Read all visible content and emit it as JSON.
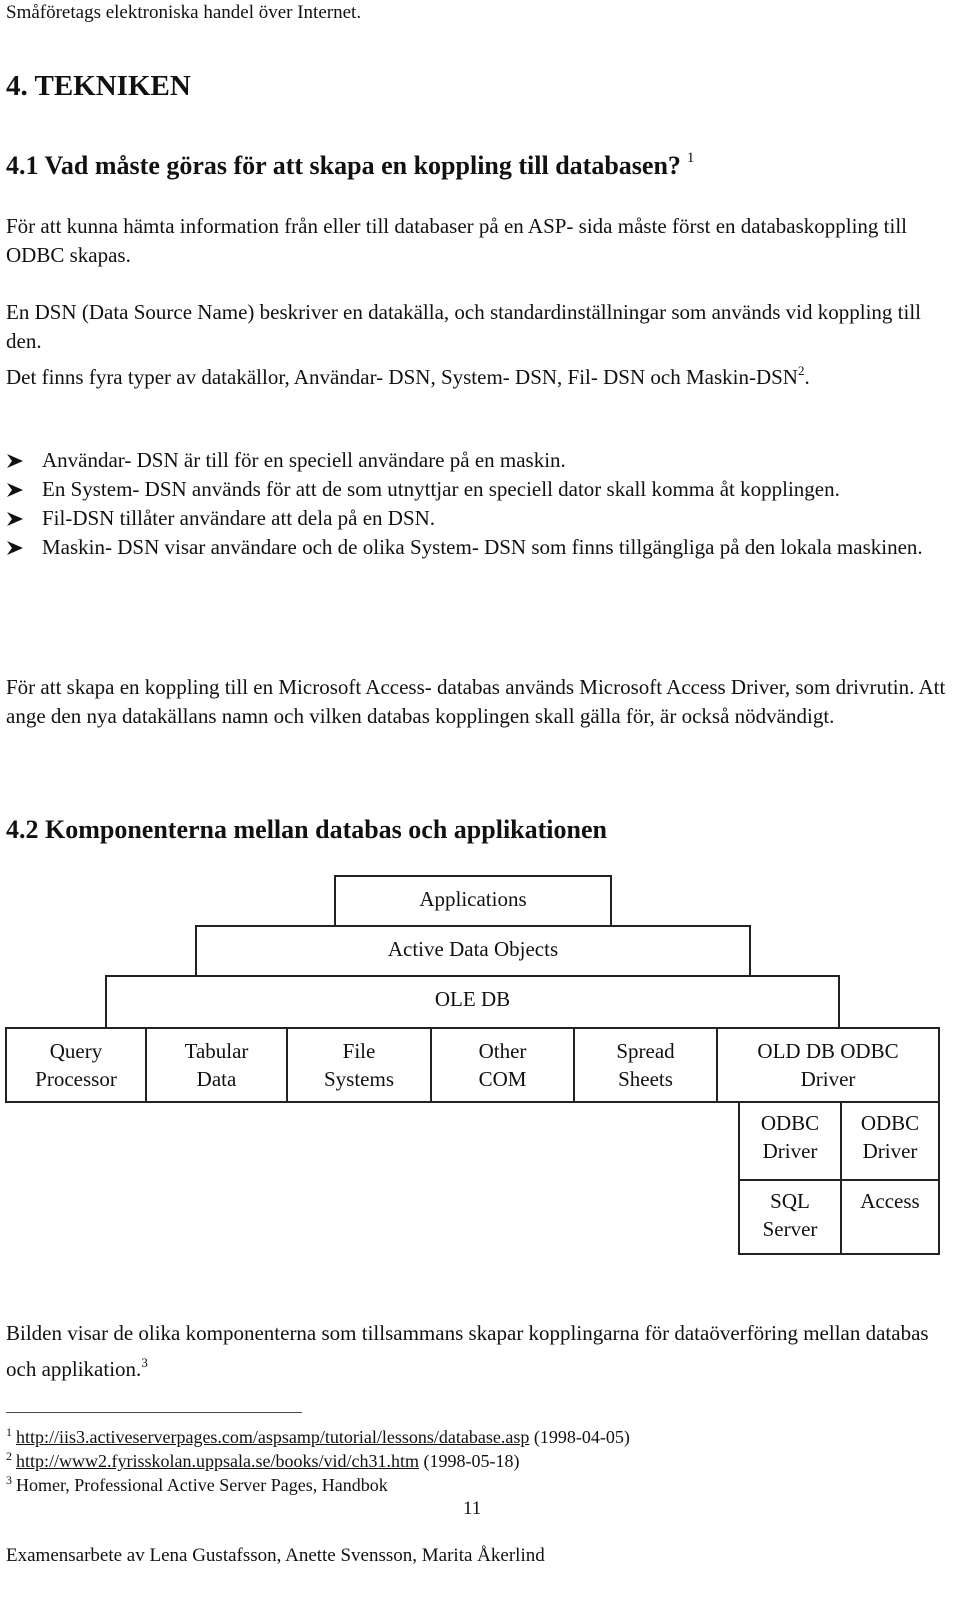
{
  "running_head": "Småföretags elektroniska handel över Internet.",
  "chapter_heading": "4. TEKNIKEN",
  "section_1": {
    "heading": "4.1 Vad måste göras för att skapa en koppling till databasen?",
    "heading_footnote_ref": "1",
    "paragraph_1": "För att kunna hämta information från eller till databaser på en ASP- sida måste först en databaskoppling till ODBC skapas.",
    "paragraph_2_line_1": "En DSN (Data Source Name) beskriver en datakälla, och standardinställningar som används vid koppling till den.",
    "paragraph_2_line_2": "Det finns fyra typer av datakällor, Användar- DSN,  System- DSN, Fil- DSN och Maskin-DSN",
    "paragraph_2_footnote_ref": "2",
    "paragraph_2_end": ".",
    "bullets": [
      "Användar- DSN är till för en speciell användare på en maskin.",
      "En System- DSN används för att de som utnyttjar en speciell dator skall komma åt kopplingen.",
      "Fil-DSN tillåter användare att dela på en DSN.",
      "Maskin- DSN visar användare och de olika System- DSN som finns tillgängliga på den lokala maskinen."
    ],
    "paragraph_3": "För att skapa en koppling till en Microsoft Access- databas används Microsoft Access Driver, som drivrutin. Att ange den nya datakällans namn och vilken databas kopplingen skall gälla för, är också nödvändigt."
  },
  "section_2": {
    "heading": "4.2 Komponenterna mellan databas och applikationen",
    "diagram": {
      "applications": "Applications",
      "ado": "Active Data Objects",
      "oledb": "OLE DB",
      "providers": [
        "Query\nProcessor",
        "Tabular\nData",
        "File\nSystems",
        "Other\nCOM",
        "Spread\nSheets",
        "OLD DB ODBC\nDriver"
      ],
      "odbc_drivers": [
        "ODBC\nDriver",
        "ODBC\nDriver"
      ],
      "databases": [
        "SQL\nServer",
        "Access"
      ]
    },
    "caption": "Bilden visar de olika komponenterna som tillsammans skapar kopplingarna för dataöverföring mellan databas och applikation.",
    "caption_footnote_ref": "3"
  },
  "footnotes": [
    {
      "num": "1",
      "link": "http://iis3.activeserverpages.com/aspsamp/tutorial/lessons/database.asp",
      "text": " (1998-04-05)"
    },
    {
      "num": "2",
      "link": "http://www2.fyrisskolan.uppsala.se/books/vid/ch31.htm",
      "text": " (1998-05-18)"
    },
    {
      "num": "3",
      "link": "",
      "text": "Homer, Professional Active Server Pages, Handbok"
    }
  ],
  "page_number": "11",
  "footer": "Examensarbete av Lena Gustafsson, Anette Svensson, Marita Åkerlind"
}
